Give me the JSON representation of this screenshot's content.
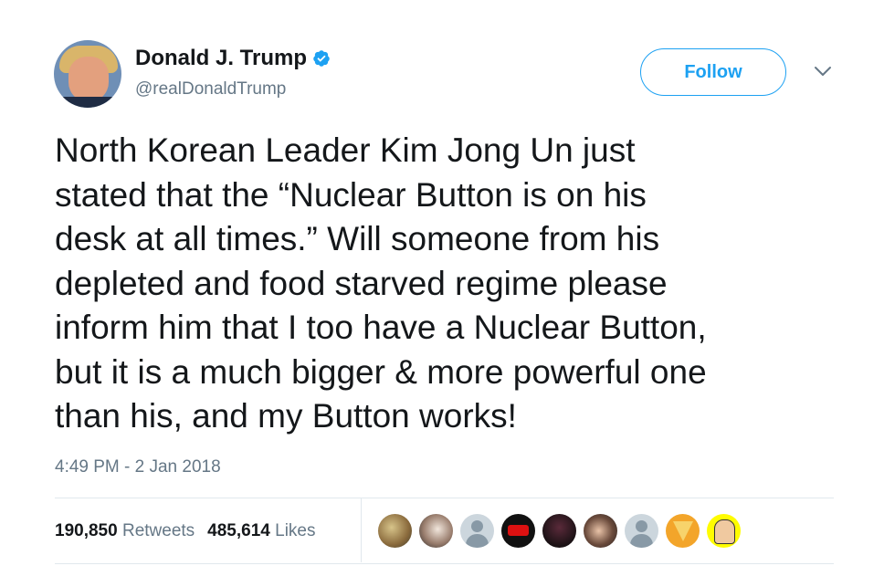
{
  "tweet": {
    "author": {
      "name": "Donald J. Trump",
      "handle": "@realDonaldTrump",
      "verified": true,
      "verified_icon": "verified-badge-icon"
    },
    "follow_label": "Follow",
    "menu_icon": "chevron-down-icon",
    "text": "North Korean Leader Kim Jong Un just\nstated that the “Nuclear Button is on his\ndesk at all times.” Will someone from his\ndepleted and food starved regime please\ninform him that I too have a Nuclear Button,\nbut it is a much bigger & more powerful one\nthan his, and my Button works!",
    "timestamp": "4:49 PM - 2 Jan 2018",
    "stats": {
      "retweets_count": "190,850",
      "retweets_label": "Retweets",
      "likes_count": "485,614",
      "likes_label": "Likes"
    },
    "likers_shown": 9
  },
  "colors": {
    "brand_blue": "#1da1f2",
    "text_primary": "#14171a",
    "text_secondary": "#657786",
    "divider": "#e1e8ed"
  }
}
